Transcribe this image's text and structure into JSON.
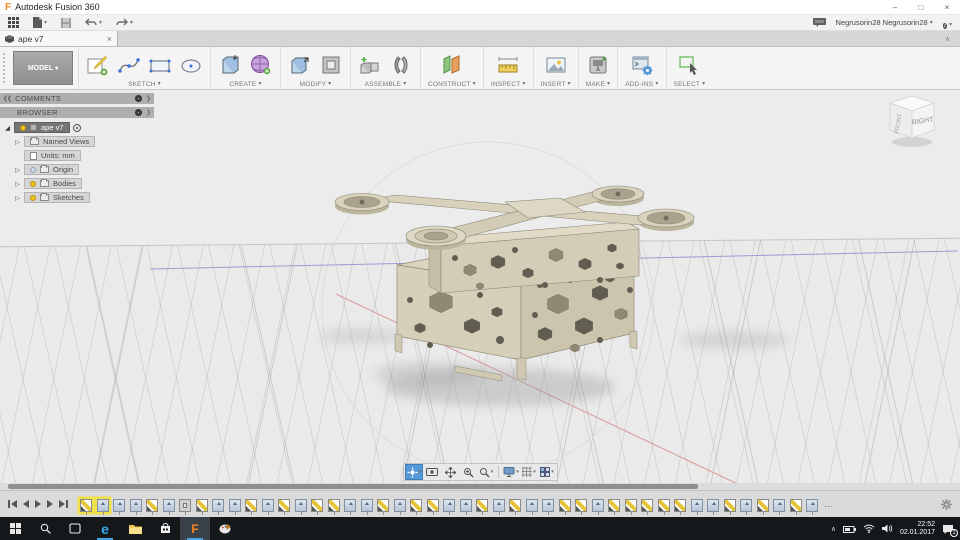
{
  "window": {
    "title": "Autodesk Fusion 360",
    "minimize": "–",
    "maximize": "□",
    "close": "×"
  },
  "qat": {
    "user": "Negrusorin28 Negrusorin28",
    "help": "?"
  },
  "tab": {
    "label": "ape v7",
    "close": "×"
  },
  "ribbon": {
    "model_label": "MODEL",
    "groups": [
      {
        "label": "SKETCH"
      },
      {
        "label": "CREATE"
      },
      {
        "label": "MODIFY"
      },
      {
        "label": "ASSEMBLE"
      },
      {
        "label": "CONSTRUCT"
      },
      {
        "label": "INSPECT"
      },
      {
        "label": "INSERT"
      },
      {
        "label": "MAKE"
      },
      {
        "label": "ADD-INS"
      },
      {
        "label": "SELECT"
      }
    ]
  },
  "browser": {
    "comments_label": "COMMENTS",
    "browser_label": "BROWSER",
    "root_label": "ape v7",
    "items": [
      {
        "label": "Named Views"
      },
      {
        "label": "Units: mm"
      },
      {
        "label": "Origin"
      },
      {
        "label": "Bodies"
      },
      {
        "label": "Sketches"
      }
    ]
  },
  "viewcube": {
    "right_face": "RIGHT",
    "front_face": "FRONT"
  },
  "navbar": {
    "buttons": [
      "orbit",
      "look-at",
      "pan",
      "zoom",
      "zoom-window",
      "display-settings",
      "grid-display",
      "viewports"
    ]
  },
  "timeline": {
    "features": [
      "sketch!",
      "extrude!",
      "extrude",
      "extrude",
      "sketch",
      "extrude",
      "box",
      "sketch",
      "extrude",
      "extrude",
      "sketch",
      "extrude",
      "sketch",
      "extrude",
      "sketch",
      "sketch",
      "extrude",
      "extrude",
      "sketch",
      "extrude",
      "sketch",
      "sketch",
      "extrude",
      "extrude",
      "sketch",
      "extrude",
      "sketch",
      "extrude",
      "extrude",
      "sketch",
      "sketch",
      "extrude",
      "sketch",
      "sketch",
      "sketch",
      "sketch",
      "sketch",
      "extrude",
      "extrude",
      "sketch",
      "extrude",
      "sketch",
      "extrude",
      "sketch",
      "extrude"
    ],
    "overflow": "…"
  },
  "taskbar": {
    "time": "22:52",
    "date": "02.01.2017",
    "badge": "1"
  },
  "icons": {
    "app-grid-icon": "3x3 grid",
    "file-icon": "page",
    "save-icon": "floppy",
    "undo-icon": "arrow-left",
    "redo-icon": "arrow-right",
    "comment-icon": "speech-bubble",
    "help-icon": "question-circle",
    "orbit-icon": "orbit",
    "pan-icon": "four-arrows",
    "zoom-icon": "magnifier",
    "gear-icon": "gear",
    "start-icon": "windows-logo",
    "search-icon": "magnifier",
    "wifi-icon": "wifi",
    "battery-icon": "battery",
    "volume-icon": "speaker",
    "notification-icon": "action-center"
  },
  "colors": {
    "accent_blue": "#5599d6",
    "axis_red": "#d99a9a",
    "axis_blue": "#9a9ad6",
    "model_body": "#d6d0ba",
    "highlight_yellow": "#f0e14a"
  }
}
